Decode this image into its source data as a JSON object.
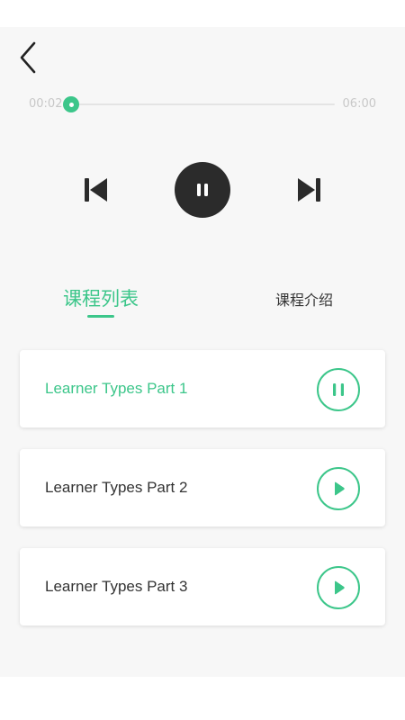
{
  "player": {
    "time_current": "00:02",
    "time_total": "06:00",
    "progress_fraction": 0.0
  },
  "tabs": {
    "active_label": "课程列表",
    "inactive_label": "课程介绍"
  },
  "lessons": [
    {
      "title": "Learner Types Part 1",
      "state": "playing"
    },
    {
      "title": "Learner Types Part 2",
      "state": "paused"
    },
    {
      "title": "Learner Types Part 3",
      "state": "paused"
    }
  ],
  "colors": {
    "accent": "#3cc68a",
    "dark_button": "#2b2b2b",
    "text": "#333333",
    "muted": "#c8c8c8",
    "background": "#f7f7f7"
  },
  "icons": {
    "back": "chevron-left-icon",
    "prev": "skip-previous-icon",
    "main": "pause-icon",
    "next": "skip-next-icon",
    "lesson_playing": "pause-icon",
    "lesson_paused": "play-icon"
  }
}
